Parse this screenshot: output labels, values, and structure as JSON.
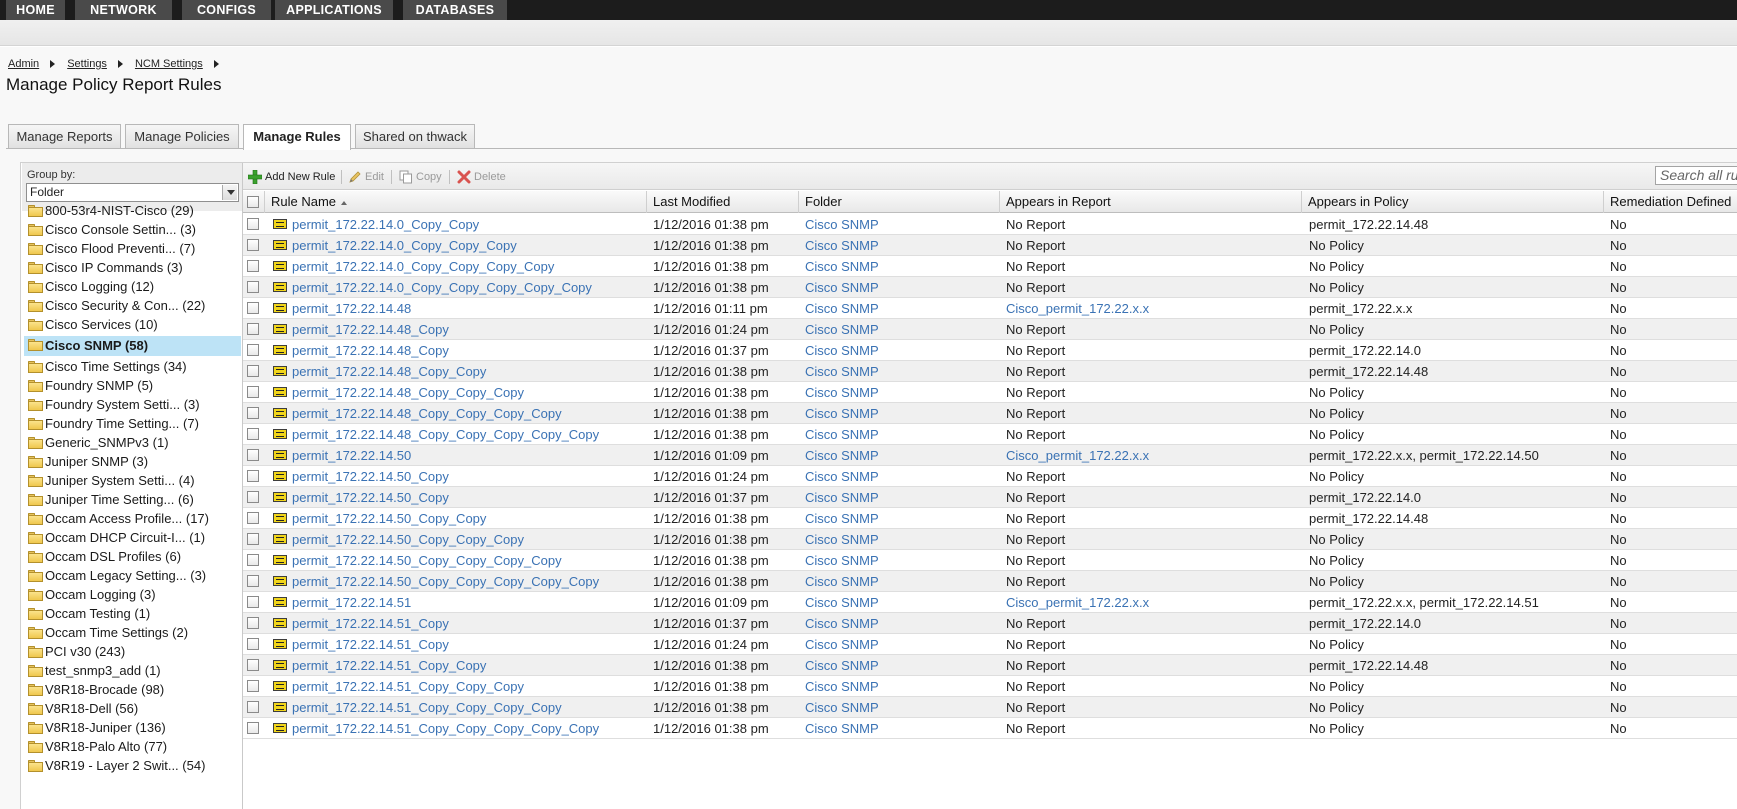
{
  "nav": [
    "HOME",
    "NETWORK",
    "CONFIGS",
    "APPLICATIONS",
    "DATABASES"
  ],
  "breadcrumb": [
    "Admin",
    "Settings",
    "NCM Settings"
  ],
  "page_title": "Manage Policy Report Rules",
  "tabs": [
    "Manage Reports",
    "Manage Policies",
    "Manage Rules",
    "Shared on thwack"
  ],
  "active_tab": "Manage Rules",
  "groupby": {
    "label": "Group by:",
    "value": "Folder"
  },
  "folders": [
    "800-53r4-NIST-Cisco (29)",
    "Cisco Console Settin... (3)",
    "Cisco Flood Preventi... (7)",
    "Cisco IP Commands (3)",
    "Cisco Logging (12)",
    "Cisco Security & Con... (22)",
    "Cisco Services (10)",
    "Cisco SNMP (58)",
    "Cisco Time Settings (34)",
    "Foundry SNMP (5)",
    "Foundry System Setti... (3)",
    "Foundry Time Setting... (7)",
    "Generic_SNMPv3 (1)",
    "Juniper SNMP (3)",
    "Juniper System Setti... (4)",
    "Juniper Time Setting... (6)",
    "Occam Access Profile... (17)",
    "Occam DHCP Circuit-I... (1)",
    "Occam DSL Profiles (6)",
    "Occam Legacy Setting... (3)",
    "Occam Logging (3)",
    "Occam Testing (1)",
    "Occam Time Settings (2)",
    "PCI v30 (243)",
    "test_snmp3_add (1)",
    "V8R18-Brocade (98)",
    "V8R18-Dell (56)",
    "V8R18-Juniper (136)",
    "V8R18-Palo Alto (77)",
    "V8R19 - Layer 2 Swit... (54)"
  ],
  "selected_folder": "Cisco SNMP (58)",
  "toolbar": {
    "add": "Add New Rule",
    "edit": "Edit",
    "copy": "Copy",
    "delete": "Delete",
    "search_placeholder": "Search all ru"
  },
  "columns": [
    "Rule Name",
    "Last Modified",
    "Folder",
    "Appears in Report",
    "Appears in Policy",
    "Remediation Defined"
  ],
  "rows": [
    [
      "permit_172.22.14.0_Copy_Copy",
      "1/12/2016 01:38 pm",
      "Cisco SNMP",
      "No Report",
      "permit_172.22.14.48",
      "No"
    ],
    [
      "permit_172.22.14.0_Copy_Copy_Copy",
      "1/12/2016 01:38 pm",
      "Cisco SNMP",
      "No Report",
      "No Policy",
      "No"
    ],
    [
      "permit_172.22.14.0_Copy_Copy_Copy_Copy",
      "1/12/2016 01:38 pm",
      "Cisco SNMP",
      "No Report",
      "No Policy",
      "No"
    ],
    [
      "permit_172.22.14.0_Copy_Copy_Copy_Copy_Copy",
      "1/12/2016 01:38 pm",
      "Cisco SNMP",
      "No Report",
      "No Policy",
      "No"
    ],
    [
      "permit_172.22.14.48",
      "1/12/2016 01:11 pm",
      "Cisco SNMP",
      "Cisco_permit_172.22.x.x",
      "permit_172.22.x.x",
      "No"
    ],
    [
      "permit_172.22.14.48_Copy",
      "1/12/2016 01:24 pm",
      "Cisco SNMP",
      "No Report",
      "No Policy",
      "No"
    ],
    [
      "permit_172.22.14.48_Copy",
      "1/12/2016 01:37 pm",
      "Cisco SNMP",
      "No Report",
      "permit_172.22.14.0",
      "No"
    ],
    [
      "permit_172.22.14.48_Copy_Copy",
      "1/12/2016 01:38 pm",
      "Cisco SNMP",
      "No Report",
      "permit_172.22.14.48",
      "No"
    ],
    [
      "permit_172.22.14.48_Copy_Copy_Copy",
      "1/12/2016 01:38 pm",
      "Cisco SNMP",
      "No Report",
      "No Policy",
      "No"
    ],
    [
      "permit_172.22.14.48_Copy_Copy_Copy_Copy",
      "1/12/2016 01:38 pm",
      "Cisco SNMP",
      "No Report",
      "No Policy",
      "No"
    ],
    [
      "permit_172.22.14.48_Copy_Copy_Copy_Copy_Copy",
      "1/12/2016 01:38 pm",
      "Cisco SNMP",
      "No Report",
      "No Policy",
      "No"
    ],
    [
      "permit_172.22.14.50",
      "1/12/2016 01:09 pm",
      "Cisco SNMP",
      "Cisco_permit_172.22.x.x",
      "permit_172.22.x.x, permit_172.22.14.50",
      "No"
    ],
    [
      "permit_172.22.14.50_Copy",
      "1/12/2016 01:24 pm",
      "Cisco SNMP",
      "No Report",
      "No Policy",
      "No"
    ],
    [
      "permit_172.22.14.50_Copy",
      "1/12/2016 01:37 pm",
      "Cisco SNMP",
      "No Report",
      "permit_172.22.14.0",
      "No"
    ],
    [
      "permit_172.22.14.50_Copy_Copy",
      "1/12/2016 01:38 pm",
      "Cisco SNMP",
      "No Report",
      "permit_172.22.14.48",
      "No"
    ],
    [
      "permit_172.22.14.50_Copy_Copy_Copy",
      "1/12/2016 01:38 pm",
      "Cisco SNMP",
      "No Report",
      "No Policy",
      "No"
    ],
    [
      "permit_172.22.14.50_Copy_Copy_Copy_Copy",
      "1/12/2016 01:38 pm",
      "Cisco SNMP",
      "No Report",
      "No Policy",
      "No"
    ],
    [
      "permit_172.22.14.50_Copy_Copy_Copy_Copy_Copy",
      "1/12/2016 01:38 pm",
      "Cisco SNMP",
      "No Report",
      "No Policy",
      "No"
    ],
    [
      "permit_172.22.14.51",
      "1/12/2016 01:09 pm",
      "Cisco SNMP",
      "Cisco_permit_172.22.x.x",
      "permit_172.22.x.x, permit_172.22.14.51",
      "No"
    ],
    [
      "permit_172.22.14.51_Copy",
      "1/12/2016 01:37 pm",
      "Cisco SNMP",
      "No Report",
      "permit_172.22.14.0",
      "No"
    ],
    [
      "permit_172.22.14.51_Copy",
      "1/12/2016 01:24 pm",
      "Cisco SNMP",
      "No Report",
      "No Policy",
      "No"
    ],
    [
      "permit_172.22.14.51_Copy_Copy",
      "1/12/2016 01:38 pm",
      "Cisco SNMP",
      "No Report",
      "permit_172.22.14.48",
      "No"
    ],
    [
      "permit_172.22.14.51_Copy_Copy_Copy",
      "1/12/2016 01:38 pm",
      "Cisco SNMP",
      "No Report",
      "No Policy",
      "No"
    ],
    [
      "permit_172.22.14.51_Copy_Copy_Copy_Copy",
      "1/12/2016 01:38 pm",
      "Cisco SNMP",
      "No Report",
      "No Policy",
      "No"
    ],
    [
      "permit_172.22.14.51_Copy_Copy_Copy_Copy_Copy",
      "1/12/2016 01:38 pm",
      "Cisco SNMP",
      "No Report",
      "No Policy",
      "No"
    ]
  ]
}
